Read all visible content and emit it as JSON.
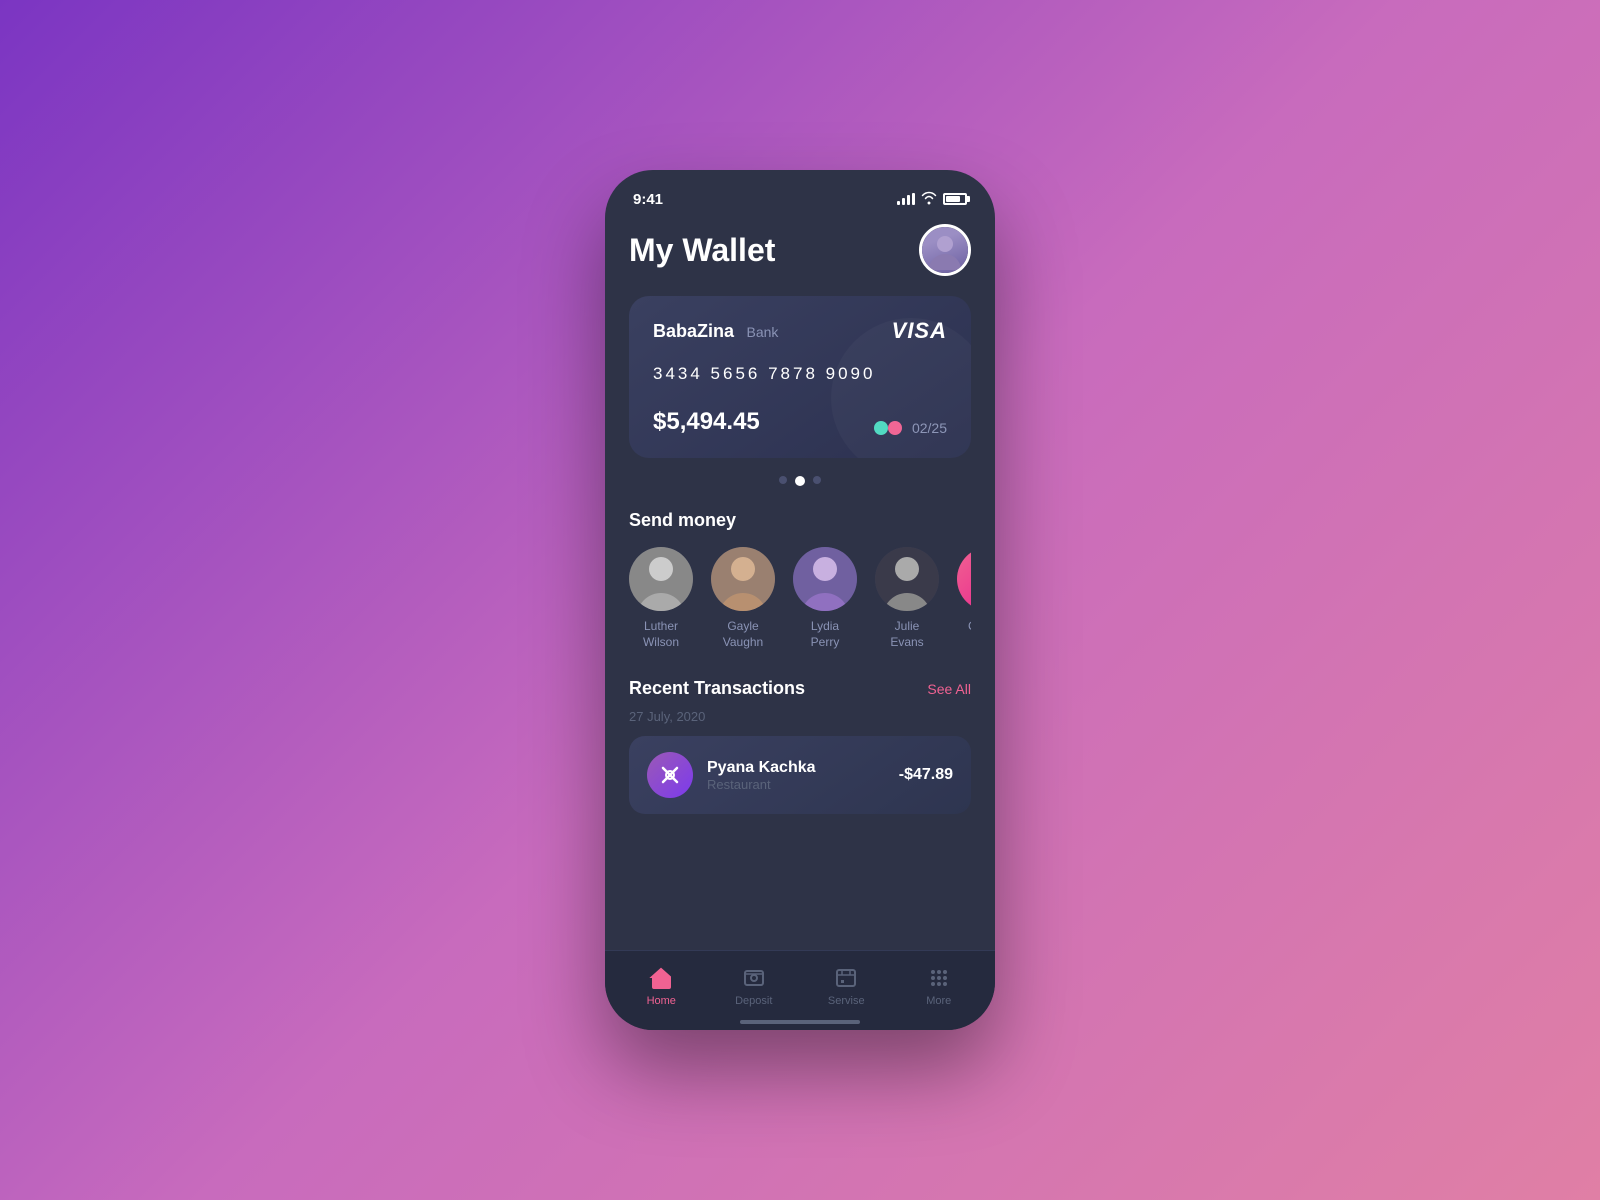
{
  "app": {
    "title": "My Wallet"
  },
  "statusBar": {
    "time": "9:41"
  },
  "card": {
    "bankName": "BabaZina",
    "bankType": "Bank",
    "cardBrand": "VISA",
    "cardNumber": "3434  5656  7878  9090",
    "balance": "$5,494.45",
    "expiry": "02/25"
  },
  "dotsIndicator": {
    "count": 3,
    "activeIndex": 1
  },
  "sendMoney": {
    "sectionTitle": "Send money",
    "contacts": [
      {
        "name": "Luther\nWilson",
        "bg": "#7a8090"
      },
      {
        "name": "Gayle\nVaughn",
        "bg": "#8a7060"
      },
      {
        "name": "Lydia\nPerry",
        "bg": "#7060a0"
      },
      {
        "name": "Julie\nEvans",
        "bg": "#3a3a4a"
      }
    ],
    "addContactLabel": "Conta..."
  },
  "transactions": {
    "sectionTitle": "Recent Transactions",
    "seeAllLabel": "See All",
    "dateLabel": "27 July, 2020",
    "items": [
      {
        "name": "Pyana Kachka",
        "category": "Restaurant",
        "amount": "-$47.89",
        "iconEmoji": "✕"
      }
    ]
  },
  "bottomNav": {
    "items": [
      {
        "label": "Home",
        "active": true
      },
      {
        "label": "Deposit",
        "active": false
      },
      {
        "label": "Servise",
        "active": false
      },
      {
        "label": "More",
        "active": false
      }
    ]
  }
}
